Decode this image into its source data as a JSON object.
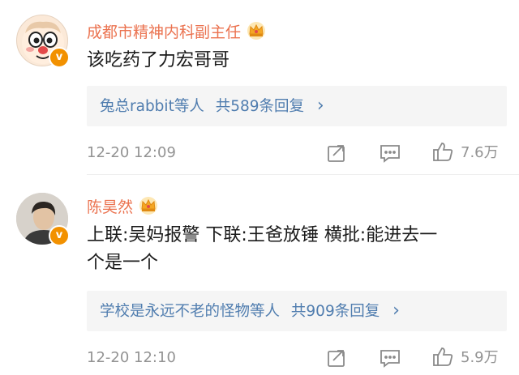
{
  "comments": [
    {
      "username": "成都市精神内科副主任",
      "text": "该吃药了力宏哥哥",
      "reply_users": "兔总rabbit等人",
      "reply_count": "共589条回复",
      "reply_chevron": "›",
      "time": "12-20 12:09",
      "likes": "7.6万",
      "badge_letter": "v"
    },
    {
      "username": "陈昊然",
      "text": "上联:吴妈报警 下联:王爸放锤 横批:能进去一个是一个",
      "reply_users": "学校是永远不老的怪物等人",
      "reply_count": "共909条回复",
      "reply_chevron": "›",
      "time": "12-20 12:10",
      "likes": "5.9万",
      "badge_letter": "v"
    }
  ],
  "icons": {
    "repost": "share-icon",
    "comment": "comment-icon",
    "like": "thumbs-up-icon",
    "crown": "crown-icon",
    "verified": "verified-badge-icon"
  },
  "colors": {
    "username": "#eb7350",
    "reply_link": "#507daf",
    "meta": "#939393",
    "verified": "#f29100"
  }
}
